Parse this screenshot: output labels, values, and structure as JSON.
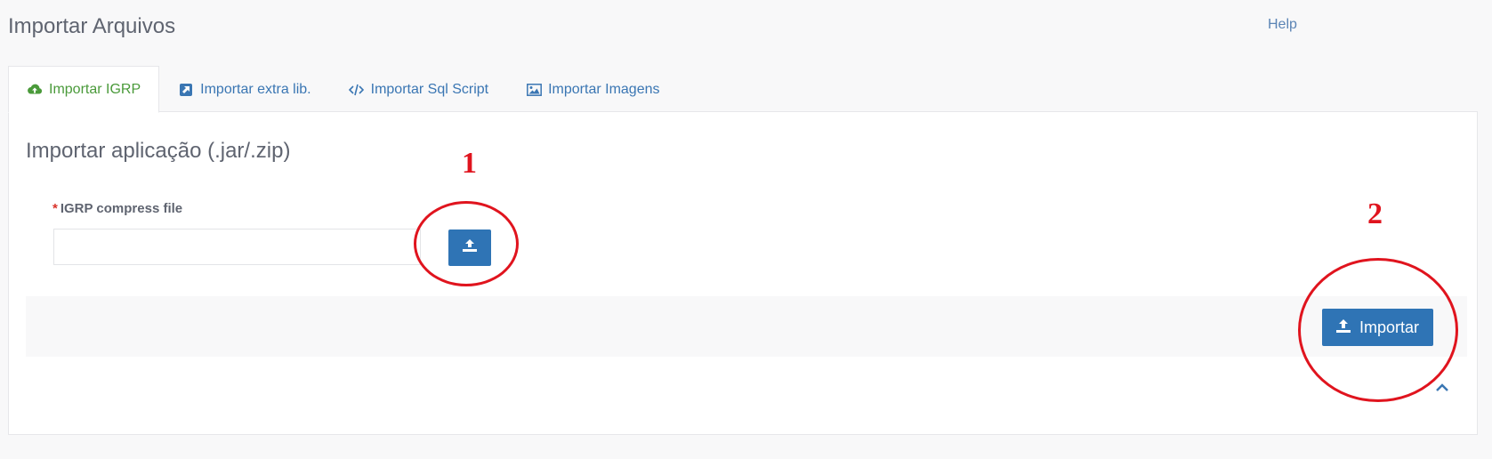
{
  "header": {
    "title": "Importar Arquivos",
    "help_label": "Help"
  },
  "tabs": [
    {
      "label": "Importar IGRP",
      "icon": "cloud-upload-icon",
      "active": true
    },
    {
      "label": "Importar extra lib.",
      "icon": "external-link-icon",
      "active": false
    },
    {
      "label": "Importar Sql Script",
      "icon": "code-icon",
      "active": false
    },
    {
      "label": "Importar Imagens",
      "icon": "image-icon",
      "active": false
    }
  ],
  "form": {
    "title": "Importar aplicação (.jar/.zip)",
    "required_marker": "*",
    "field_label": "IGRP compress file",
    "field_value": "",
    "upload_icon": "upload-icon"
  },
  "actions": {
    "import_label": "Importar",
    "scroll_top_icon": "chevron-up-icon"
  },
  "annotations": {
    "marker_1": "1",
    "marker_2": "2",
    "color": "#e0141e"
  },
  "colors": {
    "primary": "#2f74b5",
    "active_tab": "#4a9a3a",
    "link": "#3a76b3"
  }
}
